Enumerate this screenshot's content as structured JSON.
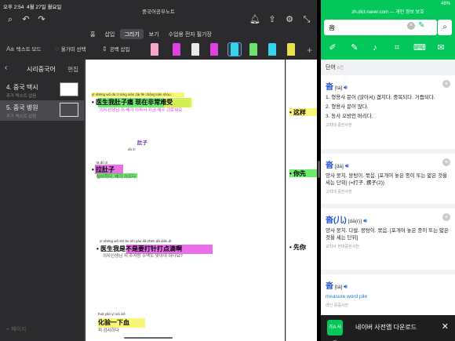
{
  "status": {
    "time": "오후 2:54",
    "date": "4월 27일 월요일"
  },
  "app": {
    "title": "중국어공부노트"
  },
  "menu_tabs": [
    "홈",
    "삽입",
    "그리기",
    "보기",
    "수업용 전자 필기장"
  ],
  "tools": {
    "text_mode": "텍스트 모드",
    "lasso": "올가미 선택",
    "insert_space": "공백 삽입"
  },
  "sidebar": {
    "back": "‹",
    "title": "시리중국어",
    "edit": "편집",
    "items": [
      {
        "name": "4. 중국 택시",
        "sub": "추가 텍스트 없음"
      },
      {
        "name": "5. 중국 병원",
        "sub": "추가 텍스트 없음"
      }
    ],
    "footer": "+ 페이지"
  },
  "note": {
    "lines": [
      {
        "pinyin": "yī shēng wǒ dù zi téng xiàn zài fēi cháng nán shòu",
        "zh": "• 医生我肚子痛 现在非常难受",
        "ko": "의사선생님 저 배가 아파서 지금 매우 괴로워요"
      },
      {
        "pinyin": "dù zi",
        "zh": "肚子",
        "ko": ""
      },
      {
        "pinyin": "lā dù zi",
        "zh": "• 拉肚子",
        "ko": "설사하다, 배가 아프다"
      },
      {
        "pinyin": "yī shēng wǒ shì bu shì yào dǎ zhēn dǎ diǎn dī",
        "zh": "• 医生我是不是要打针打点滴啊",
        "ko": "의사선생님 저 주사랑 수액도 맞아야 하나요?"
      },
      {
        "pinyin": "huà yàn yí xià xiě",
        "zh": "化验一下血",
        "ko": "피 검사하다"
      }
    ],
    "side_lines": [
      "• 这样",
      "• 你先",
      "• 先你"
    ]
  },
  "dict": {
    "url": "zh.dict.naver.com — 개인 정보 보호",
    "battery": "48%",
    "query": "沓",
    "count_label": "단어",
    "count": "6건",
    "entries": [
      {
        "word": "沓",
        "reading": "[tà]",
        "defs": [
          "1. 형용사 문어 (많아서) 겹치다. 중복되다. 거듭되다.",
          "2. 형용사 문어 많다.",
          "3. 동사 오방언 버리다."
        ],
        "source": "고려대 중한사전"
      },
      {
        "word": "沓",
        "reading": "[dá]",
        "defs": [
          "양사 뭉치. 뭉텅이. 묶음. [포개어 놓은 종이 또는 얇은 것을 세는 단위] (=打子, 摞子(2))"
        ],
        "source": "고려대 중한사전"
      },
      {
        "word": "沓(儿)",
        "reading": "[dá(r)]",
        "defs": [
          "양사 뭉치. 다발. 뭉텅이. 묶음. [포개어 놓은 종이 또는 얇은 것을 세는 단위]"
        ],
        "source": "교학사 현대중한사전"
      },
      {
        "word": "沓",
        "reading": "[tà]",
        "defs": [
          "measure word pile"
        ],
        "source": "라인 중중사전"
      }
    ],
    "ad": {
      "logo": "가A 사전",
      "text": "네이버 사전앱 다운로드"
    }
  },
  "colors": {
    "dict_green": "#03c75a",
    "link_blue": "#1a4fd1",
    "highlight_green": "#39e639",
    "highlight_yellow": "#f5f24a",
    "highlight_magenta": "#f04df0"
  }
}
